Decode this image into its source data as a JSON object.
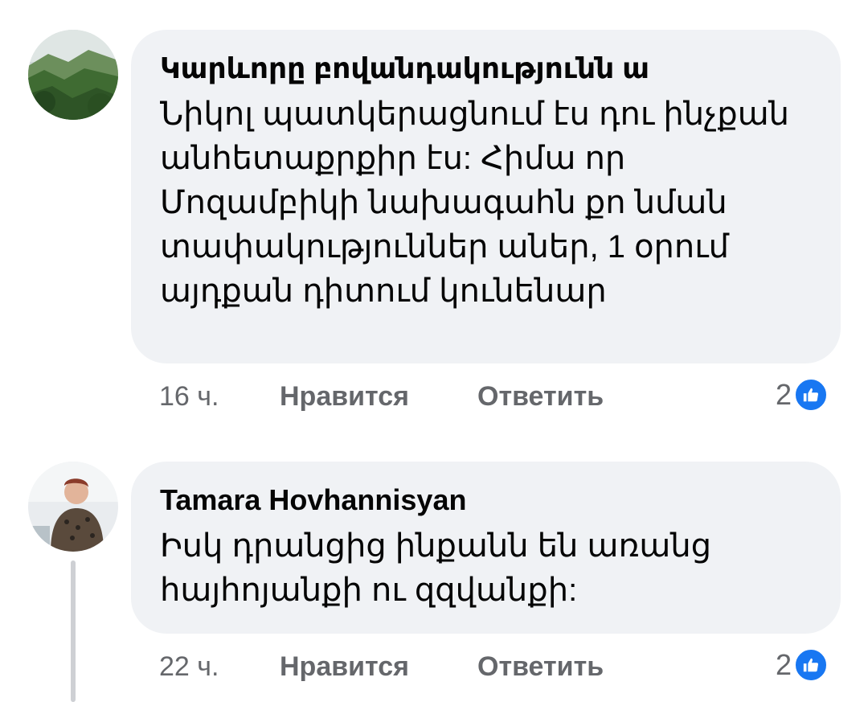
{
  "comments": [
    {
      "author": "Կարևորը բովանդակությունն ա",
      "text_lines": [
        "Նիկոլ պատկերացնում էս դու ինչքան",
        "անհետաքրքիր էս: Հիմա որ",
        "Մոզամբիկի նախագահն  քո նման",
        "տափակություններ աներ,  1 օրում",
        "այդքան դիտում կունենար"
      ],
      "time": "16 ч.",
      "like_label": "Нравится",
      "reply_label": "Ответить",
      "reaction_count": "2",
      "reaction_icon": "thumbs-up-icon"
    },
    {
      "author": "Tamara Hovhannisyan",
      "text_lines": [
        "Իսկ դրանցից ինքանն են առանց",
        "հայհոյանքի ու զզվանքի:"
      ],
      "time": "22 ч.",
      "like_label": "Нравится",
      "reply_label": "Ответить",
      "reaction_count": "2",
      "reaction_icon": "thumbs-up-icon"
    }
  ],
  "colors": {
    "bubble_bg": "#f0f2f5",
    "meta_text": "#65676b",
    "like_blue": "#1877f2"
  }
}
